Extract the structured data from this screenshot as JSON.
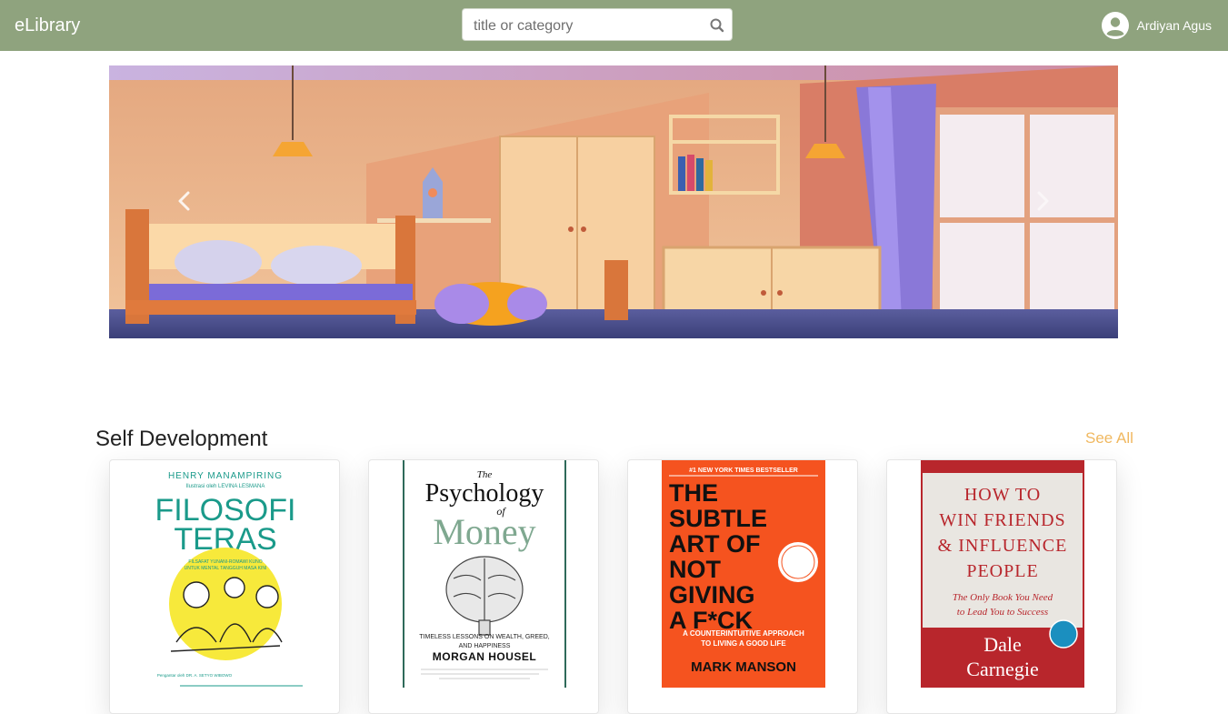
{
  "navbar": {
    "brand": "eLibrary",
    "search_placeholder": "title or category",
    "user_name": "Ardiyan Agus"
  },
  "section": {
    "title": "Self Development",
    "see_all": "See All"
  },
  "books": [
    {
      "author": "HENRY MANAMPIRING",
      "illustrator": "Ilustrasi oleh LEVINA LESMANA",
      "title_line1": "FILOSOFI",
      "title_line2": "TERAS",
      "subtitle_line1": "FILSAFAT YUNANI-ROMAWI KUNO",
      "subtitle_line2": "UNTUK MENTAL TANGGUH MASA KINI",
      "foreword": "Pengantar oleh DR. A. SETYO WIBOWO"
    },
    {
      "title_the": "The",
      "title_word1": "Psychology",
      "title_of": "of",
      "title_word2": "Money",
      "tagline1": "TIMELESS LESSONS ON WEALTH, GREED,",
      "tagline2": "AND HAPPINESS",
      "author": "MORGAN HOUSEL"
    },
    {
      "banner": "#1 NEW YORK TIMES BESTSELLER",
      "line1": "THE",
      "line2": "SUBTLE",
      "line3": "ART OF",
      "line4": "NOT",
      "line5": "GIVING",
      "line6": "A F*CK",
      "sub1": "A COUNTERINTUITIVE APPROACH",
      "sub2": "TO LIVING A GOOD LIFE",
      "author": "MARK MANSON"
    },
    {
      "line1": "HOW TO",
      "line2": "WIN FRIENDS",
      "line3": "& INFLUENCE",
      "line4": "PEOPLE",
      "sub1": "The Only Book You Need",
      "sub2": "to Lead You to Success",
      "author1": "Dale",
      "author2": "Carnegie"
    }
  ],
  "colors": {
    "navbar": "#8fa37e",
    "see_all": "#f0b860",
    "book1_teal": "#1a9a8a",
    "book3_orange": "#f5531f",
    "book4_red": "#b8262c"
  },
  "icons": {
    "search": "search-icon",
    "avatar": "user-avatar-icon",
    "prev": "chevron-left-icon",
    "next": "chevron-right-icon"
  }
}
